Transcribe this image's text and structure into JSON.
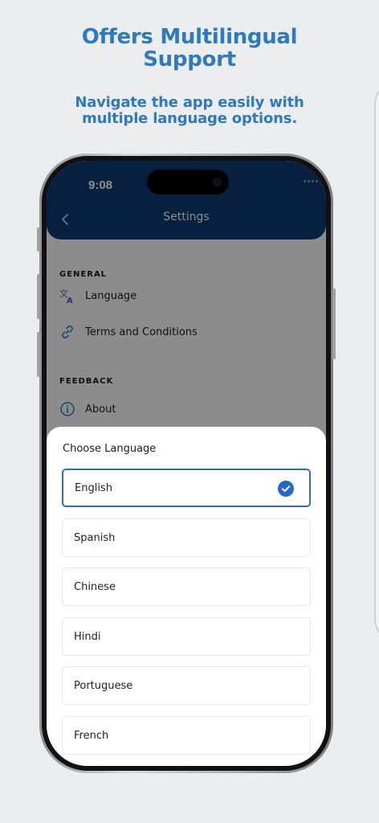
{
  "promo": {
    "headline_lines": [
      "Offers Multilingual",
      "Support"
    ],
    "subheadline_lines": [
      "Navigate the app easily with",
      "multiple language options."
    ]
  },
  "status_bar": {
    "time": "9:08",
    "icons": [
      "signal-dots-icon",
      "wifi-icon",
      "battery-icon"
    ]
  },
  "nav": {
    "back_icon": "chevron-left-icon",
    "title": "Settings"
  },
  "settings": {
    "sections": [
      {
        "label": "GENERAL",
        "items": [
          {
            "label": "Language",
            "icon": "translate-icon"
          },
          {
            "label": "Terms and Conditions",
            "icon": "link-icon"
          }
        ]
      },
      {
        "label": "FEEDBACK",
        "items": [
          {
            "label": "About",
            "icon": "info-icon"
          }
        ]
      }
    ]
  },
  "language_sheet": {
    "title": "Choose Language",
    "selected": "English",
    "options": [
      {
        "label": "English",
        "selected": true
      },
      {
        "label": "Spanish",
        "selected": false
      },
      {
        "label": "Chinese",
        "selected": false
      },
      {
        "label": "Hindi",
        "selected": false
      },
      {
        "label": "Portuguese",
        "selected": false
      },
      {
        "label": "French",
        "selected": false
      }
    ]
  },
  "colors": {
    "accent": "#2F79BD",
    "header": "#0E3B74",
    "selected_border": "#2F6DB4",
    "check": "#2169C5",
    "background": "#ECEDEF"
  }
}
